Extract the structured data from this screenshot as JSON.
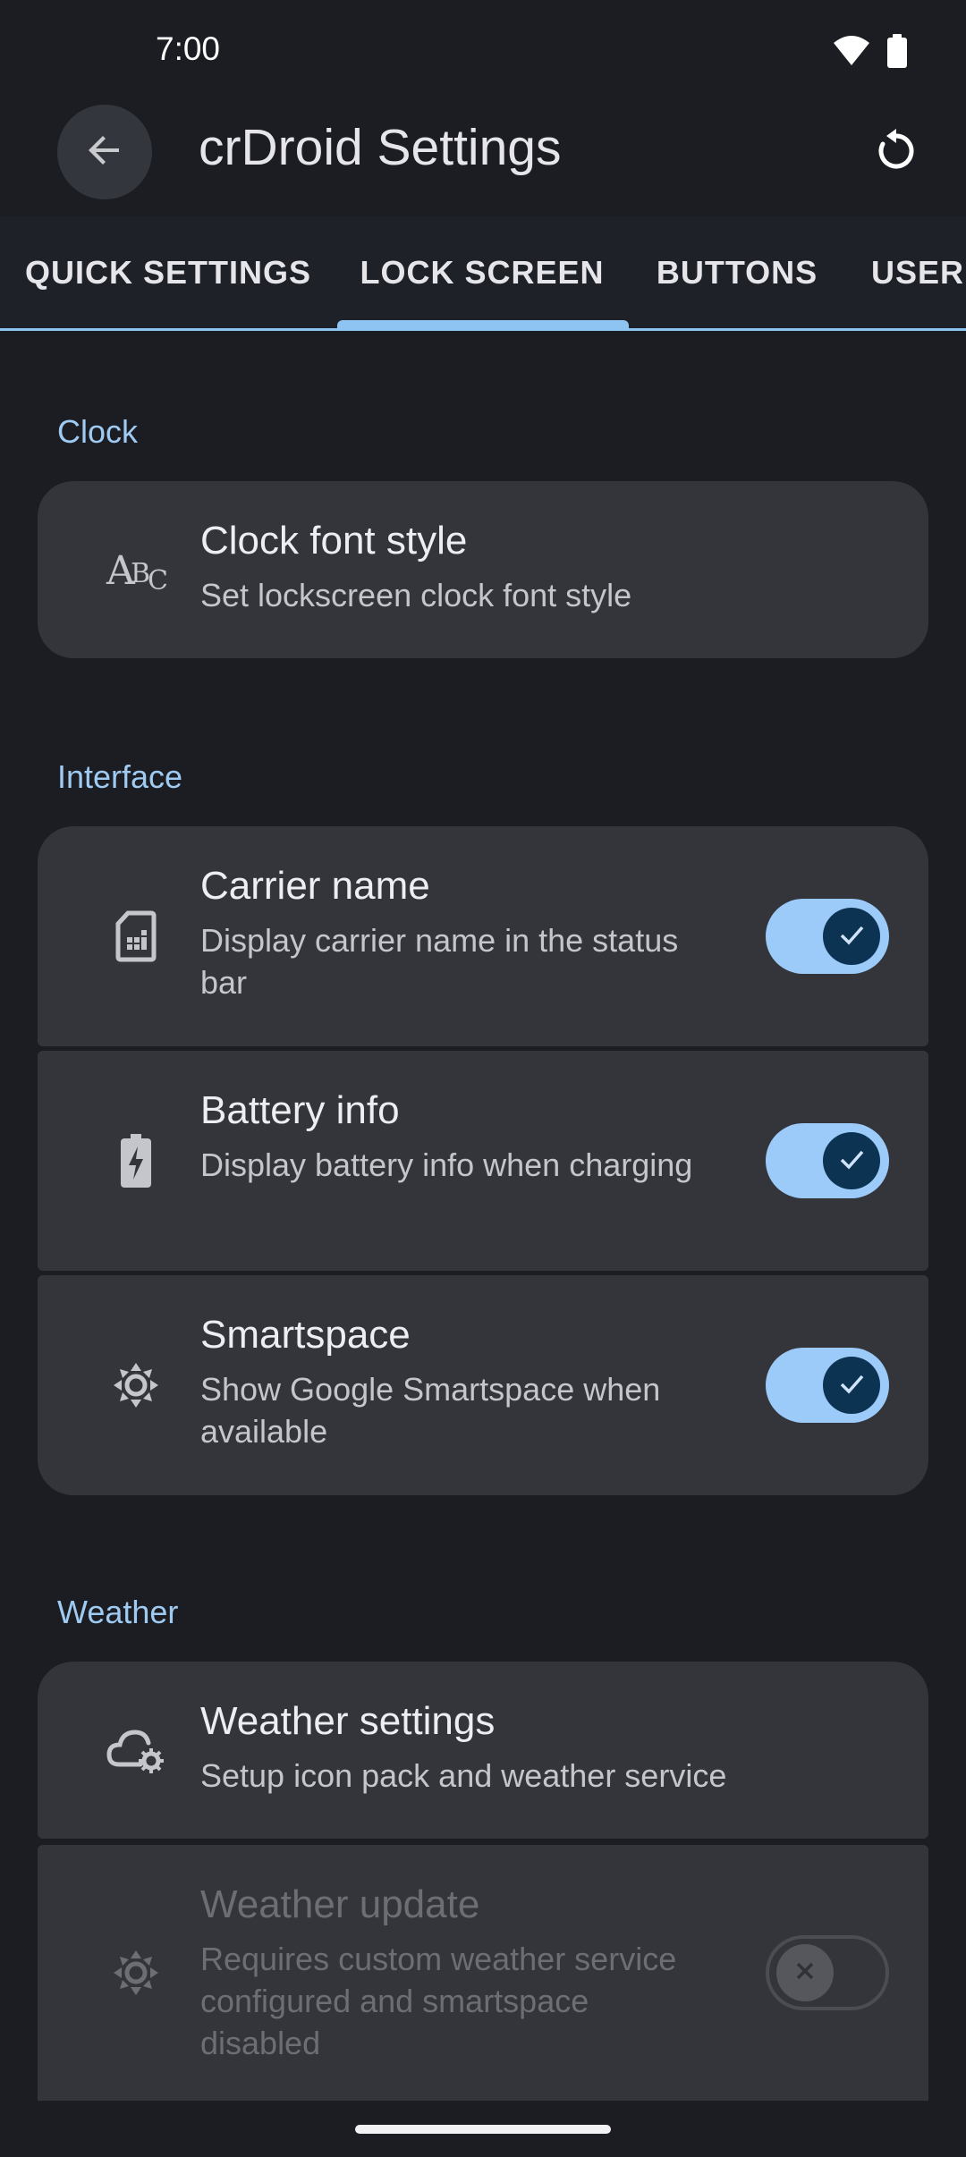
{
  "status_bar": {
    "time": "7:00"
  },
  "app_bar": {
    "title": "crDroid Settings"
  },
  "tabs": [
    {
      "label": "QUICK SETTINGS"
    },
    {
      "label": "LOCK SCREEN",
      "selected": true
    },
    {
      "label": "BUTTONS"
    },
    {
      "label": "USER"
    }
  ],
  "sections": {
    "clock": {
      "header": "Clock",
      "items": [
        {
          "icon": "font-style-icon",
          "title": "Clock font style",
          "summary": "Set lockscreen clock font style"
        }
      ]
    },
    "interface": {
      "header": "Interface",
      "items": [
        {
          "icon": "sim-card-icon",
          "title": "Carrier name",
          "summary": "Display carrier name in the status bar",
          "toggle": true
        },
        {
          "icon": "battery-charging-icon",
          "title": "Battery info",
          "summary": "Display battery info when charging",
          "toggle": true
        },
        {
          "icon": "smartspace-icon",
          "title": "Smartspace",
          "summary": "Show Google Smartspace when available",
          "toggle": true
        }
      ]
    },
    "weather": {
      "header": "Weather",
      "items": [
        {
          "icon": "weather-settings-icon",
          "title": "Weather settings",
          "summary": "Setup icon pack and weather service"
        },
        {
          "icon": "weather-update-icon",
          "title": "Weather update",
          "summary": "Requires custom weather service configured and smartspace disabled",
          "toggle": false,
          "disabled": true
        }
      ]
    }
  },
  "colors": {
    "background": "#1b1d22",
    "card": "#33353b",
    "accent": "#9fcaf2",
    "toggle_on_track": "#9ccbfa",
    "toggle_on_thumb": "#0c3352"
  }
}
